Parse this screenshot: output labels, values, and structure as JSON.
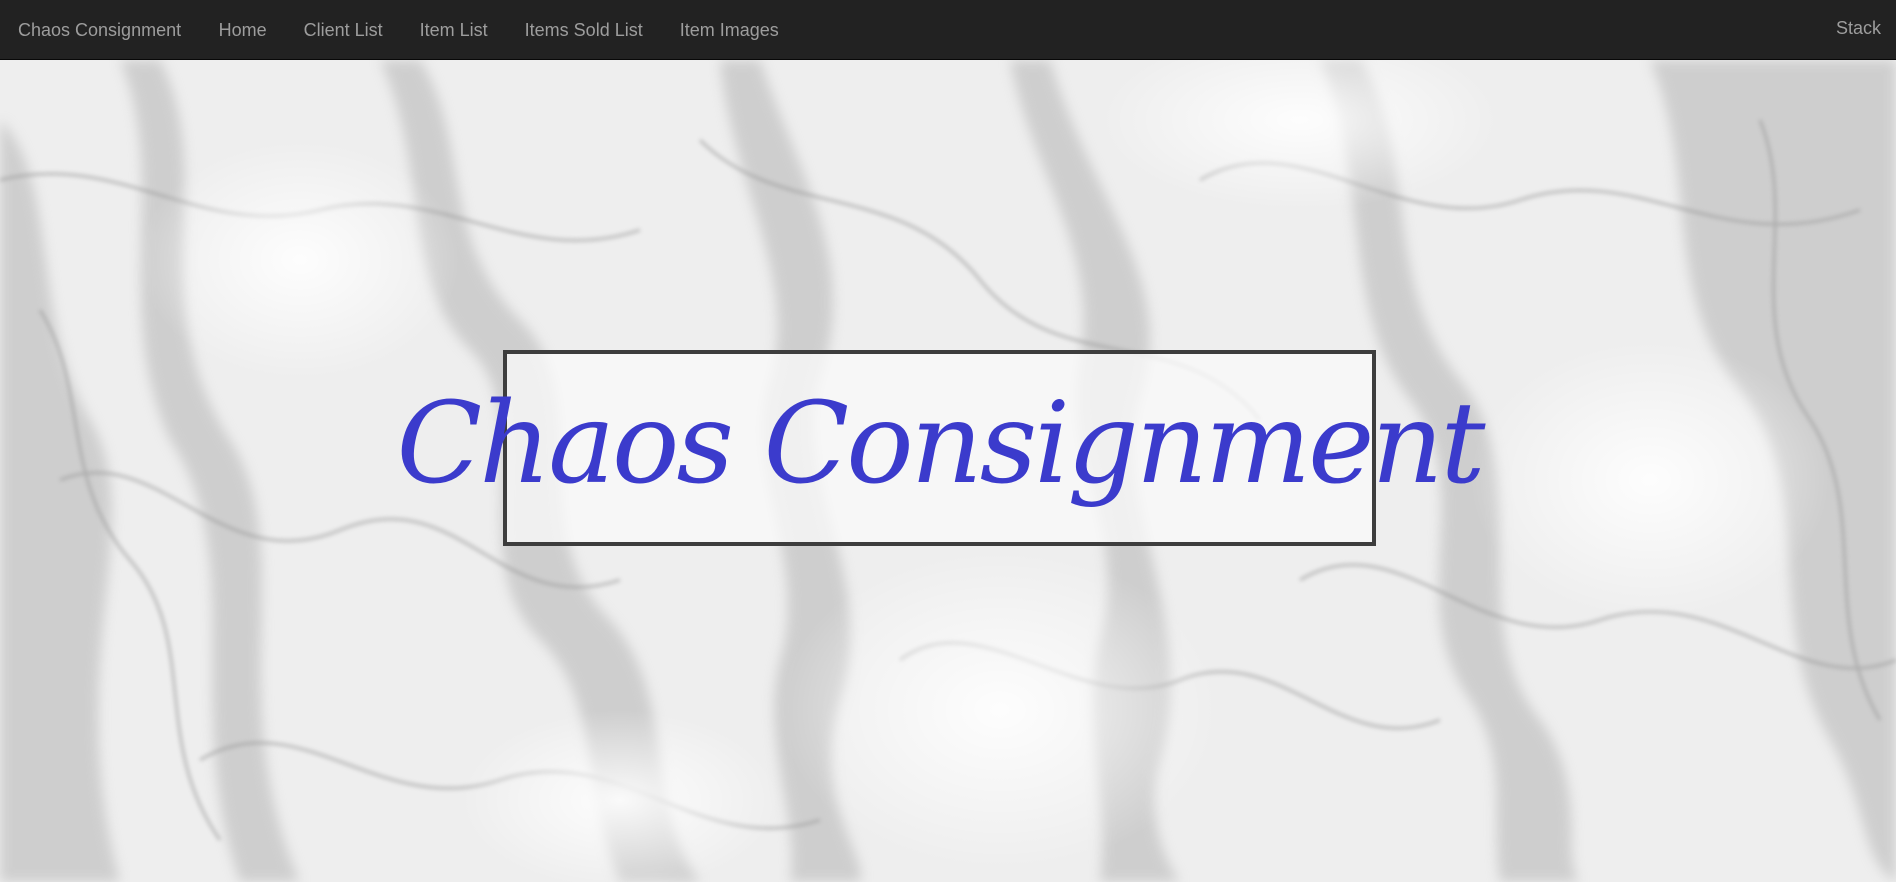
{
  "navbar": {
    "brand": "Chaos Consignment",
    "links": [
      {
        "label": "Home"
      },
      {
        "label": "Client List"
      },
      {
        "label": "Item List"
      },
      {
        "label": "Items Sold List"
      },
      {
        "label": "Item Images"
      }
    ],
    "right_link": "Stack",
    "colors": {
      "background": "#222222",
      "text": "#9d9d9d"
    }
  },
  "hero": {
    "title": "Chaos Consignment",
    "title_color": "#3b3bcc",
    "background_description_icon": "grey-smoke-background"
  }
}
